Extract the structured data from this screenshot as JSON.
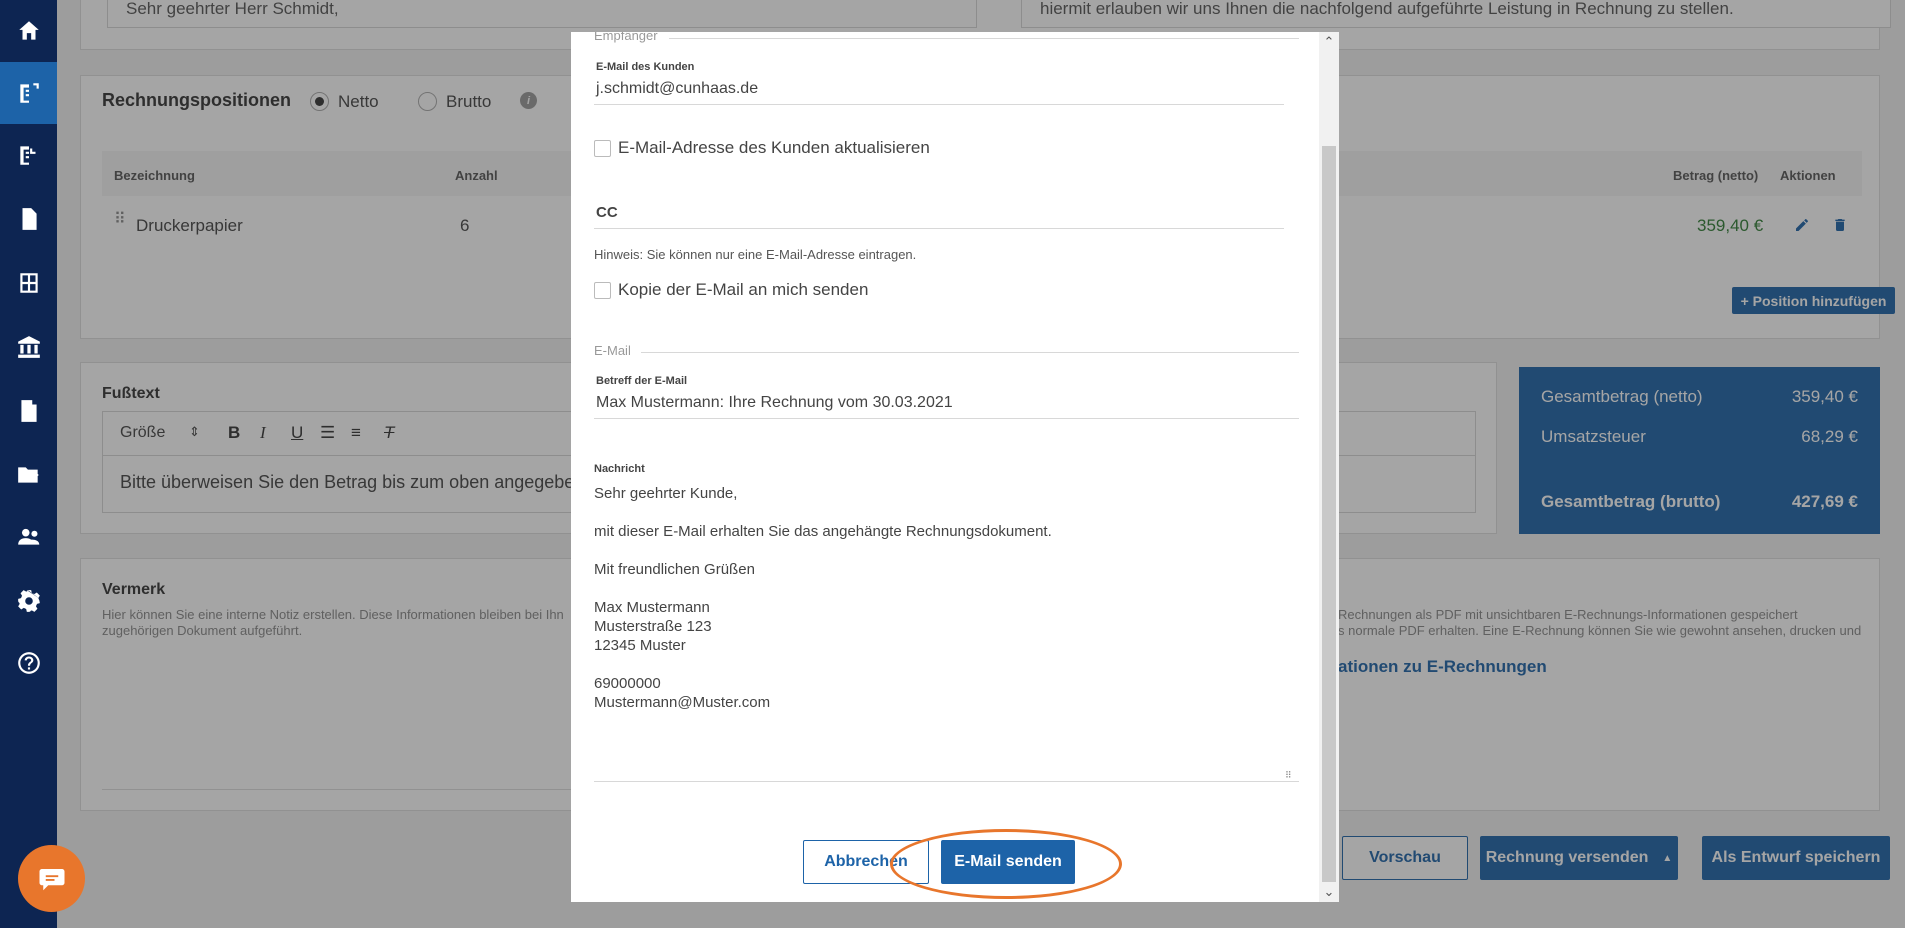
{
  "sidebar": {
    "items": [
      {
        "icon": "home-icon"
      },
      {
        "icon": "outgoing-invoices-icon"
      },
      {
        "icon": "incoming-invoices-icon"
      },
      {
        "icon": "document-icon"
      },
      {
        "icon": "calculator-icon"
      },
      {
        "icon": "bank-icon"
      },
      {
        "icon": "receipt-icon"
      },
      {
        "icon": "folder-export-icon"
      },
      {
        "icon": "contacts-icon"
      },
      {
        "icon": "settings-icon"
      },
      {
        "icon": "help-icon"
      }
    ]
  },
  "background": {
    "greeting": "Sehr geehrter Herr Schmidt,",
    "intro": "hiermit erlauben wir uns Ihnen die nachfolgend aufgeführte Leistung in Rechnung zu stellen.",
    "positions": {
      "title": "Rechnungspositionen",
      "netto_label": "Netto",
      "brutto_label": "Brutto",
      "col_bezeichnung": "Bezeichnung",
      "col_anzahl": "Anzahl",
      "col_betrag": "Betrag (netto)",
      "col_aktionen": "Aktionen",
      "row_name": "Druckerpapier",
      "row_qty": "6",
      "row_amount": "359,40 €",
      "add_button": "+ Position hinzufügen"
    },
    "footer_text": {
      "title": "Fußtext",
      "font_size_select": "Größe",
      "content": "Bitte überweisen Sie den Betrag bis zum oben angegeben"
    },
    "totals": {
      "net_label": "Gesamtbetrag (netto)",
      "net_value": "359,40 €",
      "vat_label": "Umsatzsteuer",
      "vat_value": "68,29 €",
      "gross_label": "Gesamtbetrag (brutto)",
      "gross_value": "427,69 €"
    },
    "note": {
      "title": "Vermerk",
      "desc1": "Hier können Sie eine interne Notiz erstellen. Diese Informationen bleiben bei Ihn",
      "desc2": "zugehörigen Dokument aufgeführt."
    },
    "erechnung": {
      "text1": "Rechnungen als PDF mit unsichtbaren E-Rechnungs-Informationen gespeichert",
      "text2": "s normale PDF erhalten. Eine E-Rechnung können Sie wie gewohnt ansehen, drucken und",
      "link": "ationen zu E-Rechnungen"
    },
    "actions": {
      "preview": "Vorschau",
      "send_invoice": "Rechnung versenden",
      "save_draft": "Als Entwurf speichern"
    }
  },
  "modal": {
    "recipient_section": "Empfänger",
    "customer_email_label": "E-Mail des Kunden",
    "customer_email_value": "j.schmidt@cunhaas.de",
    "update_email_label": "E-Mail-Adresse des Kunden aktualisieren",
    "cc_label": "CC",
    "cc_hint": "Hinweis: Sie können nur eine E-Mail-Adresse eintragen.",
    "copy_me_label": "Kopie der E-Mail an mich senden",
    "email_section": "E-Mail",
    "subject_label": "Betreff der E-Mail",
    "subject_value": "Max Mustermann: Ihre Rechnung vom 30.03.2021",
    "message_label": "Nachricht",
    "message": {
      "salutation": "Sehr geehrter Kunde,",
      "body": "mit dieser E-Mail erhalten Sie das angehängte Rechnungsdokument.",
      "closing": "Mit freundlichen Grüßen",
      "name": "Max Mustermann",
      "street": "Musterstraße 123",
      "city": "12345 Muster",
      "phone": "69000000",
      "email": "Mustermann@Muster.com"
    },
    "cancel_button": "Abbrechen",
    "send_button": "E-Mail senden"
  }
}
